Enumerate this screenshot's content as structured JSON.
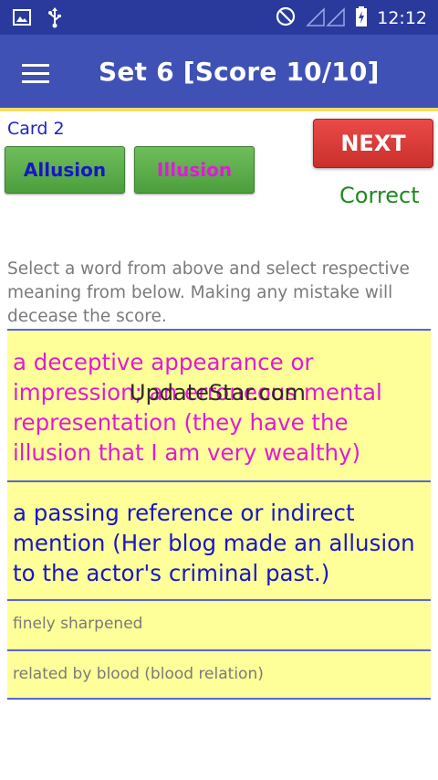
{
  "status_bar": {
    "time": "12:12",
    "icons": [
      "image-icon",
      "usb-icon",
      "do-not-disturb-icon",
      "signal-icon",
      "battery-icon"
    ]
  },
  "toolbar": {
    "menu_icon": "hamburger-menu-icon",
    "title": "Set 6 [Score 10/10]"
  },
  "card": {
    "label": "Card 2"
  },
  "words": [
    {
      "label": "Allusion",
      "color": "#1616c8"
    },
    {
      "label": "Illusion",
      "color": "#e01ad8"
    }
  ],
  "next_label": "NEXT",
  "result": "Correct",
  "instructions": "Select a word from above and select respective meaning from below. Making any mistake will decease the score.",
  "meanings": [
    {
      "text": "a deceptive appearance or impression; an erroneous mental representation (they have the illusion that I am very wealthy)",
      "color": "#e01ad8"
    },
    {
      "text": "a passing reference or indirect mention (Her blog made an allusion to the actor's criminal past.)",
      "color": "#1616c8"
    },
    {
      "text": "finely sharpened"
    },
    {
      "text": "related by blood  (blood relation)"
    }
  ],
  "watermark": "UpdateStar.com",
  "colors": {
    "status_bar": "#2a3a9c",
    "toolbar": "#3f51b5",
    "toolbar_underline": "#f2df64",
    "meaning_bg": "#ffff99",
    "next_button": "#d9383a",
    "word_button": "#5cae4a"
  }
}
